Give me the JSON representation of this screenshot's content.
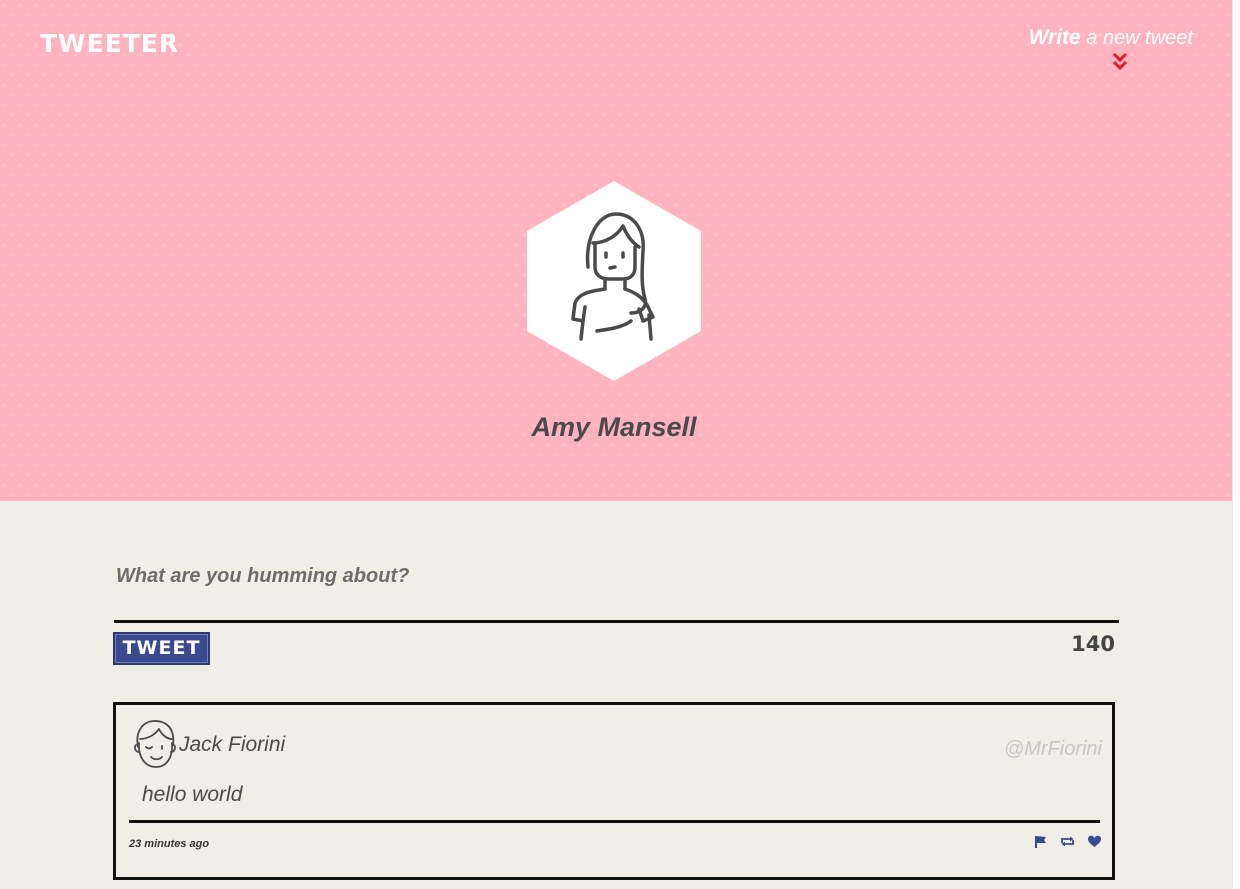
{
  "header": {
    "logo": "TWEETER",
    "compose_toggle": {
      "strong": "Write",
      "rest": " a new tweet"
    },
    "compose_toggle_icon": "double-chevron-down-icon",
    "accent_color": "#e0192b",
    "background_color": "#ffb3bf"
  },
  "profile": {
    "name": "Amy Mansell",
    "avatar_icon": "woman-avatar-icon"
  },
  "composer": {
    "placeholder": "What are you humming about?",
    "tweet_button_label": "TWEET",
    "char_counter": "140",
    "button_color": "#3b4a8e"
  },
  "tweets": [
    {
      "author_name": "Jack Fiorini",
      "handle": "@MrFiorini",
      "avatar_icon": "man-avatar-icon",
      "content": "hello world",
      "timestamp": "23 minutes ago",
      "actions": [
        "flag-icon",
        "retweet-icon",
        "heart-icon"
      ]
    }
  ]
}
